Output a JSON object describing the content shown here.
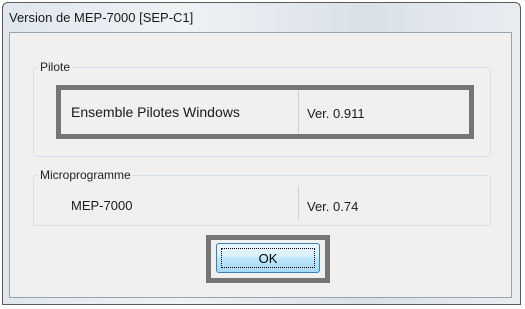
{
  "window": {
    "title": "Version de MEP-7000 [SEP-C1]"
  },
  "groups": {
    "pilote": {
      "legend": "Pilote",
      "name": "Ensemble Pilotes Windows",
      "version": "Ver. 0.911"
    },
    "microprogramme": {
      "legend": "Microprogramme",
      "name": "MEP-7000",
      "version": "Ver. 0.74"
    }
  },
  "buttons": {
    "ok_label": "OK"
  },
  "colors": {
    "highlight_border": "#757575",
    "button_border": "#3c7fb1",
    "dialog_background": "#f0f0f0"
  }
}
